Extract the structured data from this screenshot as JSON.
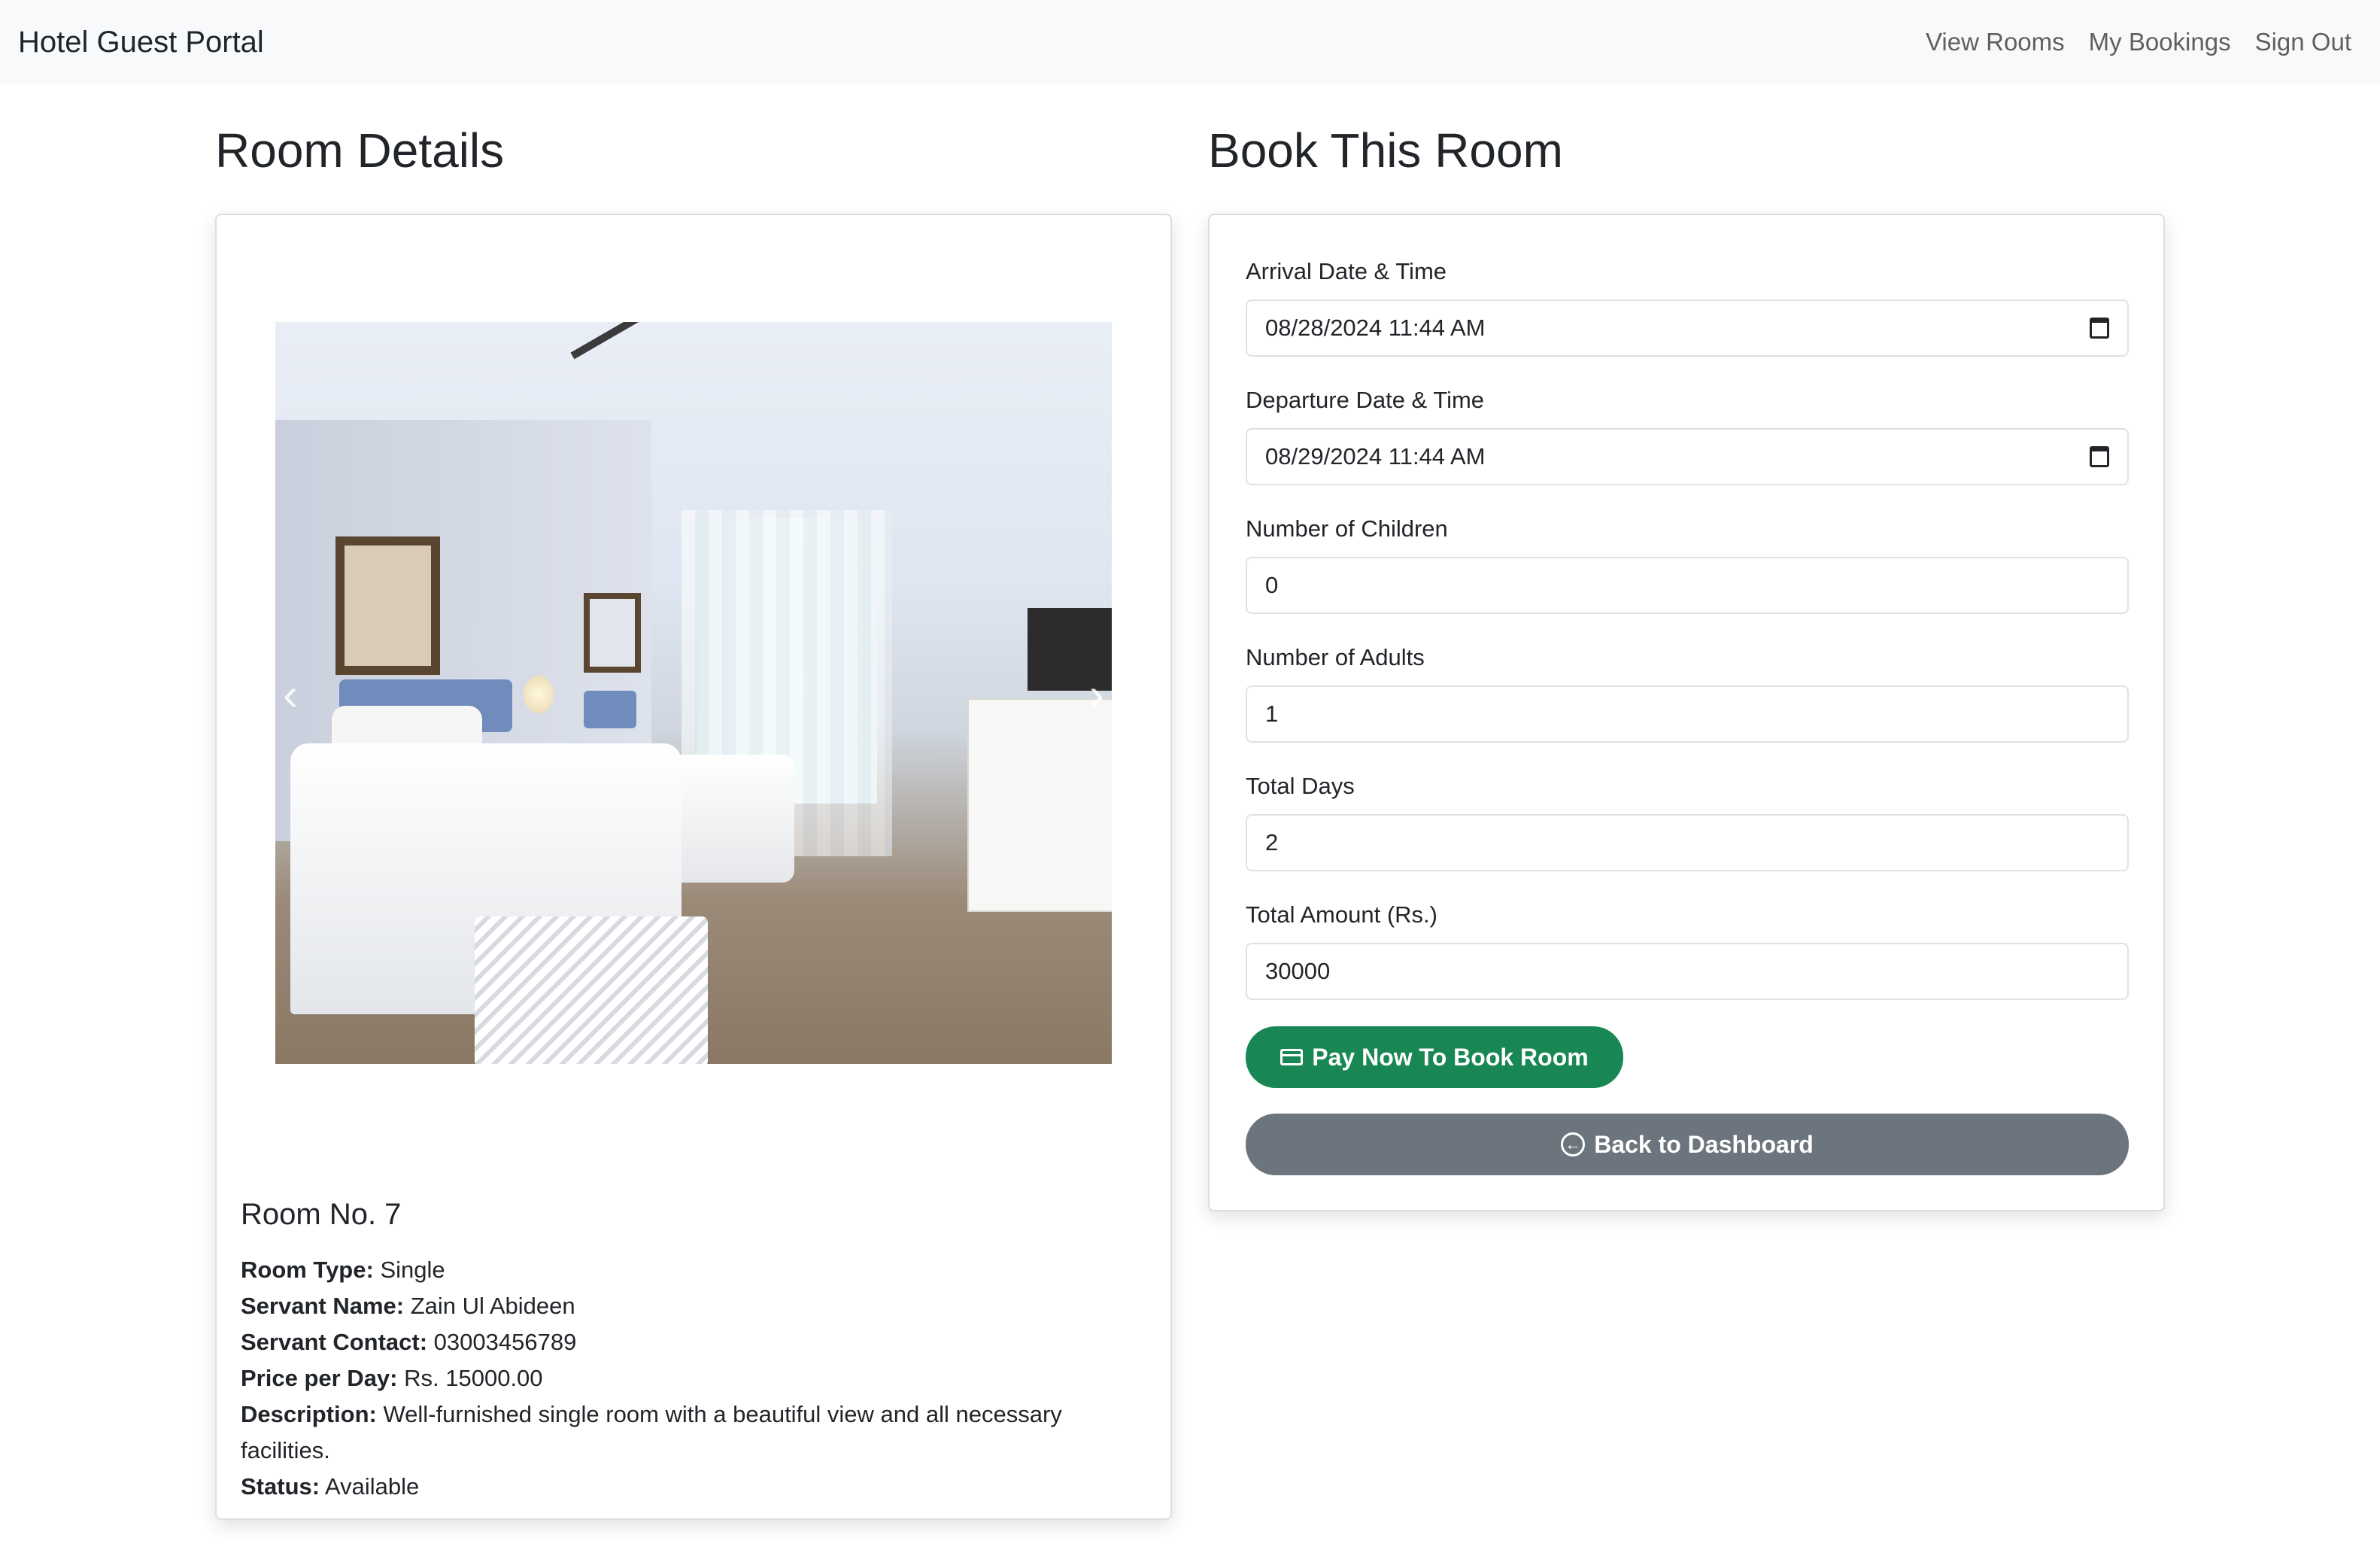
{
  "navbar": {
    "brand": "Hotel Guest Portal",
    "links": [
      "View Rooms",
      "My Bookings",
      "Sign Out"
    ]
  },
  "room_details": {
    "heading": "Room Details",
    "room_title": "Room No. 7",
    "fields": [
      {
        "label": "Room Type:",
        "value": "Single"
      },
      {
        "label": "Servant Name:",
        "value": "Zain Ul Abideen"
      },
      {
        "label": "Servant Contact:",
        "value": "03003456789"
      },
      {
        "label": "Price per Day:",
        "value": "Rs. 15000.00"
      },
      {
        "label": "Description:",
        "value": "Well-furnished single room with a beautiful view and all necessary facilities."
      },
      {
        "label": "Status:",
        "value": "Available"
      }
    ],
    "carousel": {
      "prev_icon": "chevron-left-icon",
      "next_icon": "chevron-right-icon"
    }
  },
  "booking": {
    "heading": "Book This Room",
    "fields": [
      {
        "label": "Arrival Date & Time",
        "value": "08/28/2024 11:44 AM"
      },
      {
        "label": "Departure Date & Time",
        "value": "08/29/2024 11:44 AM"
      },
      {
        "label": "Number of Children",
        "value": "0"
      },
      {
        "label": "Number of Adults",
        "value": "1"
      },
      {
        "label": "Total Days",
        "value": "2"
      },
      {
        "label": "Total Amount (Rs.)",
        "value": "30000"
      }
    ],
    "pay_button": "Pay Now To Book Room",
    "back_button": "Back to Dashboard"
  },
  "colors": {
    "navbar_bg": "#f8f9fa",
    "pay_button": "#198754",
    "back_button": "#6c757d"
  }
}
